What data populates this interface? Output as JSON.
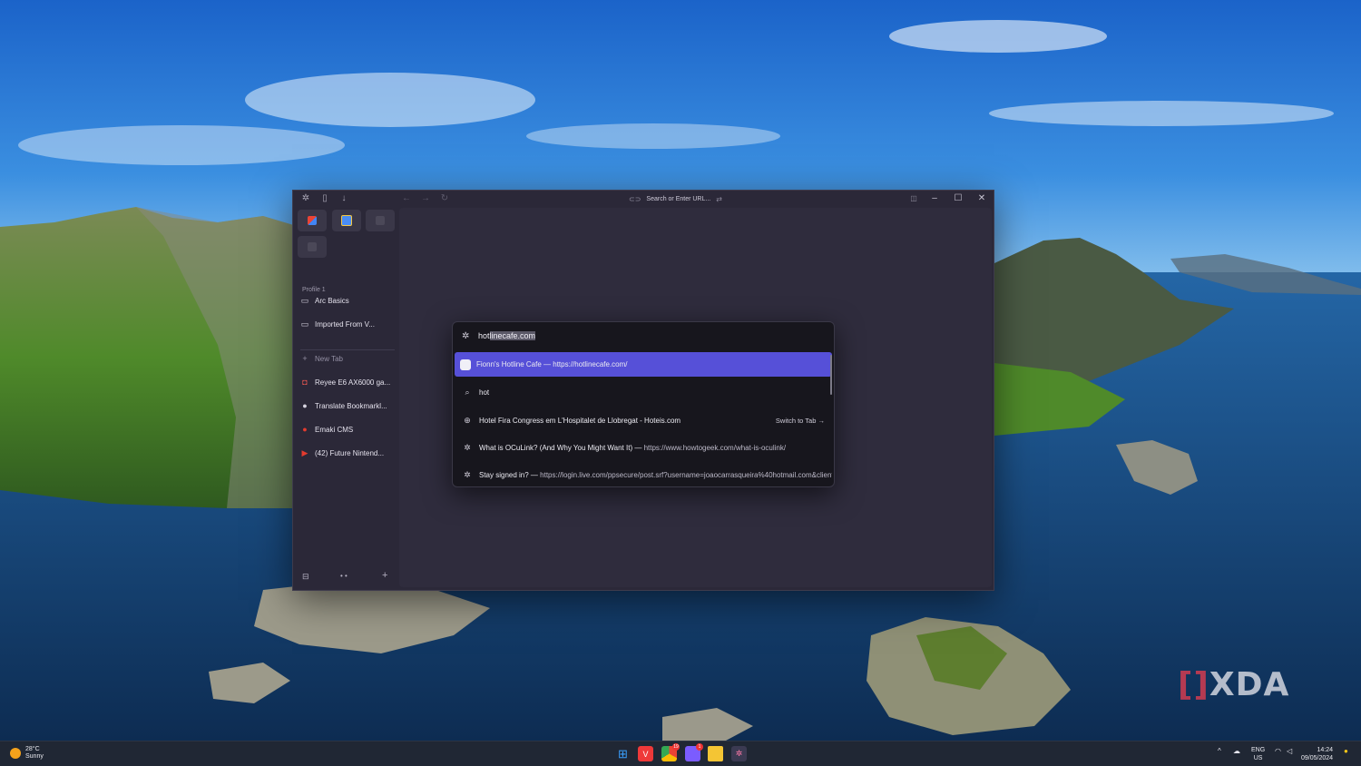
{
  "browser": {
    "url_placeholder": "Search or Enter URL...",
    "sidebar": {
      "profile_label": "Profile 1",
      "folders": [
        {
          "label": "Arc Basics",
          "icon": "folder-icon"
        },
        {
          "label": "Imported From V...",
          "icon": "folder-icon"
        }
      ],
      "new_tab_label": "New Tab",
      "tabs": [
        {
          "label": "Reyee E6 AX6000 ga...",
          "icon": "reyee-icon"
        },
        {
          "label": "Translate Bookmarkl...",
          "icon": "github-icon"
        },
        {
          "label": "Emaki CMS",
          "icon": "emaki-icon"
        },
        {
          "label": "(42) Future Nintend...",
          "icon": "youtube-icon"
        }
      ]
    }
  },
  "command_bar": {
    "typed_prefix": "hot",
    "autocomplete_suffix": "linecafe.com",
    "results": [
      {
        "title": "Fionn's Hotline Cafe",
        "url": "https://hotlinecafe.com/",
        "icon": "site-favicon",
        "active": true
      },
      {
        "title": "hot",
        "url": "",
        "icon": "search-icon"
      },
      {
        "title": "Hotel Fira Congress em L'Hospitalet de Llobregat - Hoteis.com",
        "url": "",
        "icon": "globe-icon",
        "action": "Switch to Tab"
      },
      {
        "title": "What is OCuLink? (And Why You Might Want It)",
        "url": "https://www.howtogeek.com/what-is-oculink/",
        "icon": "sparkle-icon"
      },
      {
        "title": "Stay signed in?",
        "url": "https://login.live.com/ppsecure/post.srf?username=joaocarrasqueira%40hotmail.com&client_",
        "icon": "sparkle-icon"
      }
    ],
    "separator": " — "
  },
  "taskbar": {
    "weather_temp": "28°C",
    "weather_desc": "Sunny",
    "lang_top": "ENG",
    "lang_bottom": "US",
    "time": "14:24",
    "date": "09/05/2024",
    "badges": {
      "chrome": "19",
      "teams": "1"
    }
  },
  "watermark": "XDA"
}
